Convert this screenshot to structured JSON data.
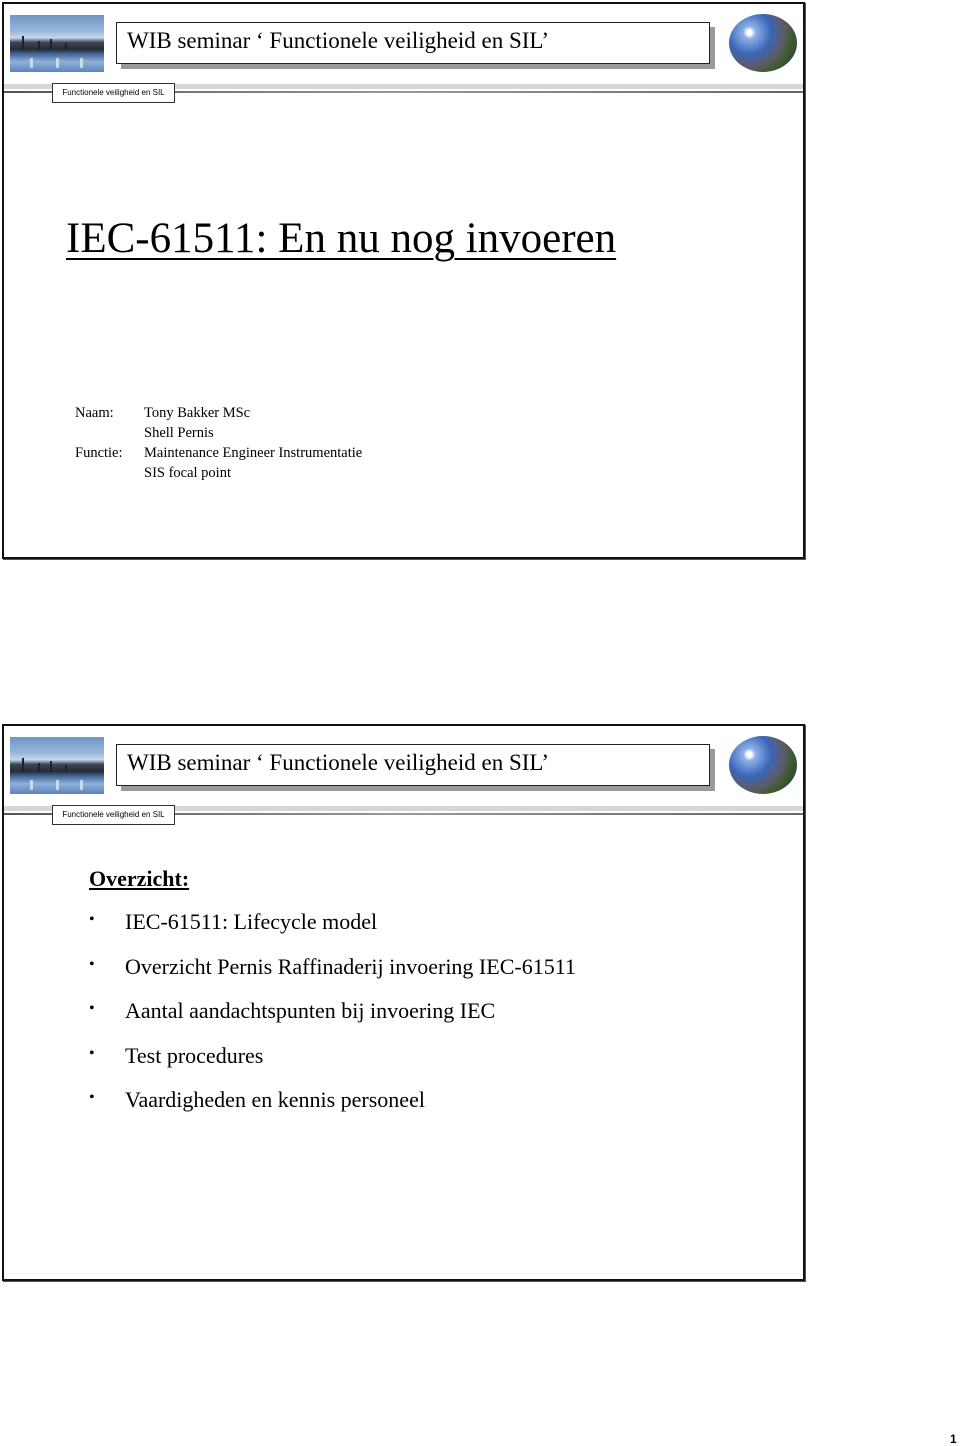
{
  "slides": [
    {
      "header": {
        "title": "WIB seminar ‘ Functionele veiligheid en SIL’",
        "tag": "Functionele veiligheid en SIL",
        "left_image": "refinery-photo",
        "right_image": "globe-icon"
      },
      "title": "IEC-61511: En nu nog invoeren",
      "info": [
        {
          "label": "Naam:",
          "value": "Tony Bakker MSc"
        },
        {
          "label": "",
          "value": "Shell Pernis"
        },
        {
          "label": "Functie:",
          "value": "Maintenance Engineer Instrumentatie"
        },
        {
          "label": "",
          "value": "SIS focal point"
        }
      ]
    },
    {
      "header": {
        "title": "WIB seminar ‘ Functionele veiligheid en SIL’",
        "tag": "Functionele veiligheid en SIL",
        "left_image": "refinery-photo",
        "right_image": "globe-icon"
      },
      "heading": "Overzicht:",
      "bullet_char": "•",
      "bullets": [
        "IEC-61511: Lifecycle model",
        "Overzicht Pernis Raffinaderij invoering IEC-61511",
        "Aantal aandachtspunten bij invoering IEC",
        "Test procedures",
        "Vaardigheden en kennis personeel"
      ]
    }
  ],
  "page_number": "1"
}
